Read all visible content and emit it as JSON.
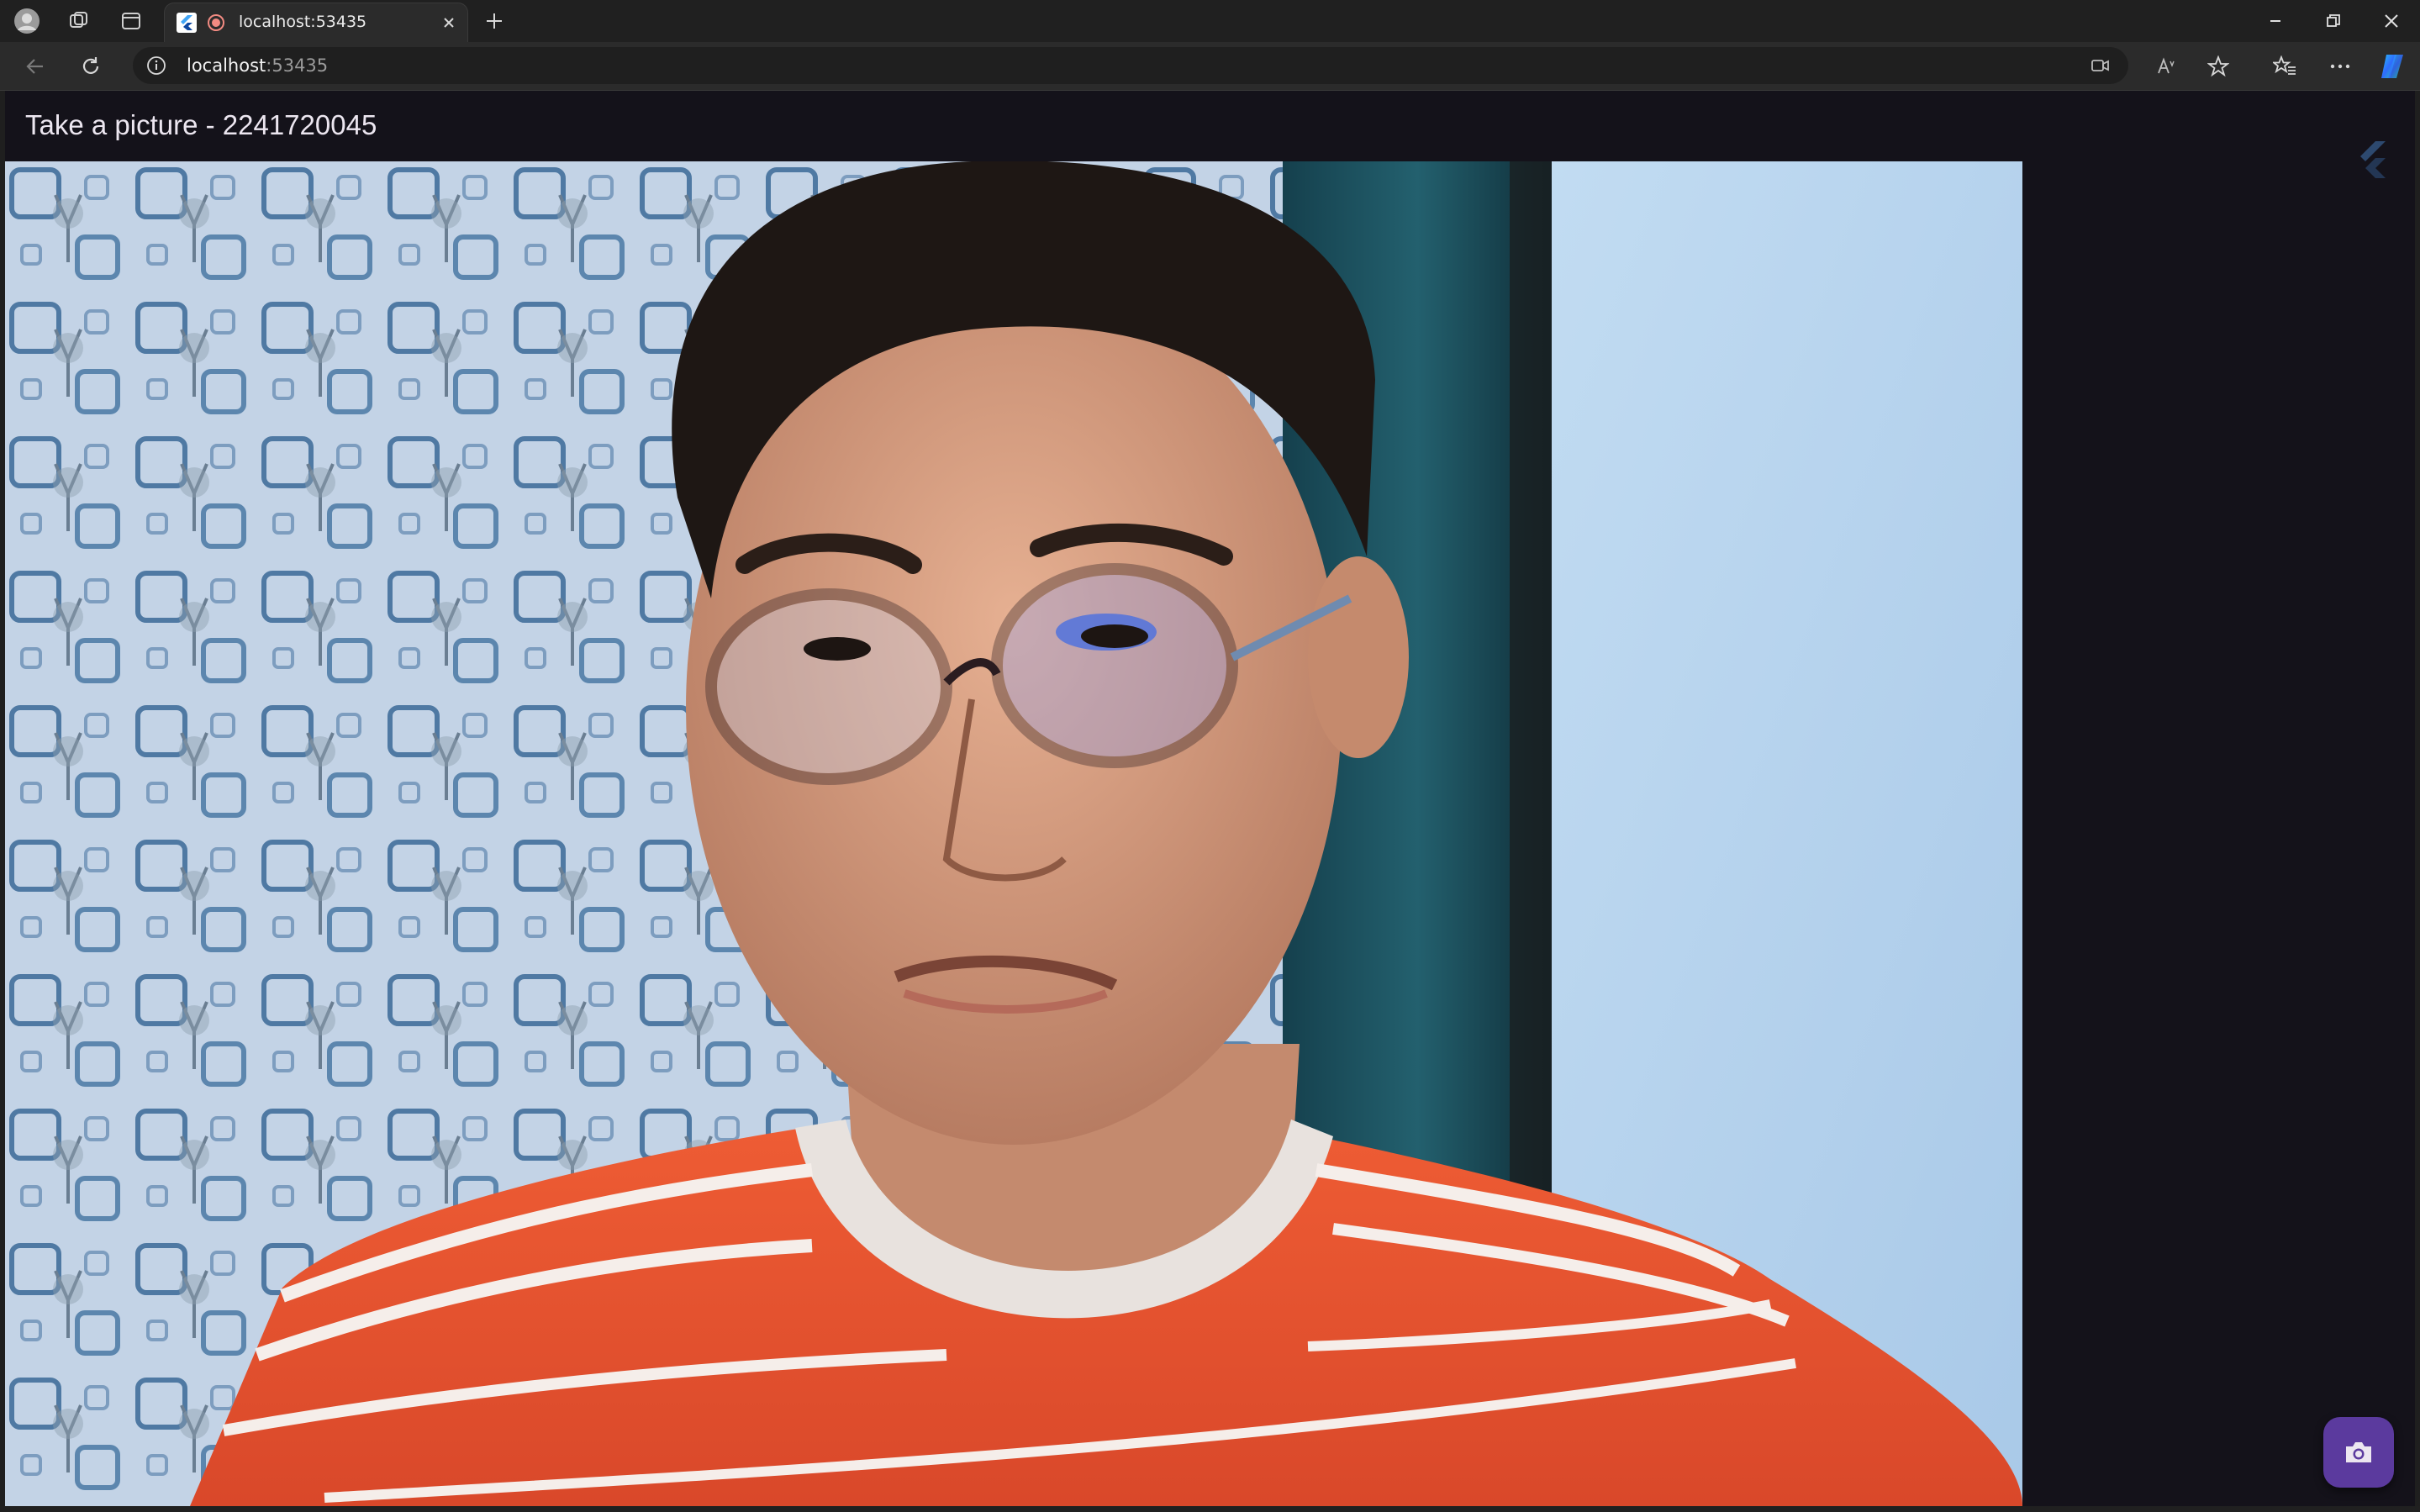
{
  "browser": {
    "tab": {
      "title": "localhost:53435",
      "favicon_icon": "flutter-logo-icon",
      "recording_indicator": "camera-recording-icon"
    },
    "address_bar": {
      "host": "localhost",
      "port": ":53435"
    },
    "toolbar_icons": [
      "back-arrow-icon",
      "reload-icon",
      "site-info-icon",
      "camera-in-use-icon",
      "read-aloud-icon",
      "favorite-star-icon",
      "favorites-list-icon",
      "more-menu-icon",
      "copilot-icon"
    ],
    "window_controls": [
      "minimize-icon",
      "restore-icon",
      "close-icon"
    ]
  },
  "app": {
    "title": "Take a picture - 2241720045",
    "fab_icon": "camera-icon",
    "background_color": "#14121a",
    "fab_color": "#5b3a9e"
  },
  "preview": {
    "description_colors": {
      "wallpaper": "#b9cbe0",
      "wall_right": "#b7d3ee",
      "curtain": "#1f4a56",
      "shirt": "#e2532e"
    }
  }
}
